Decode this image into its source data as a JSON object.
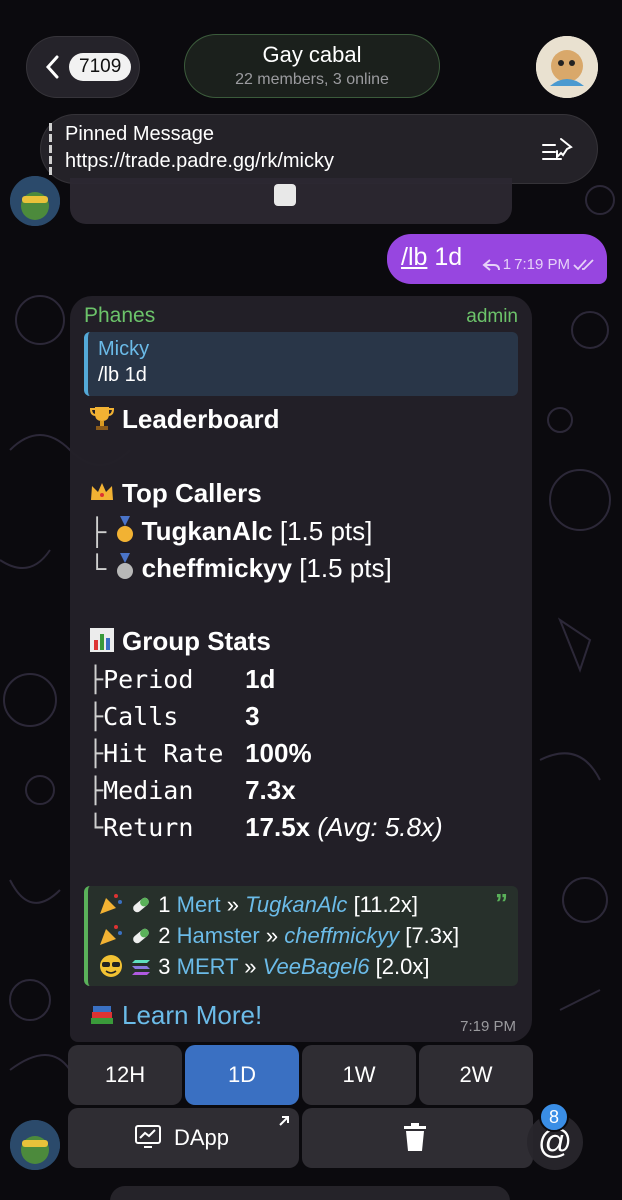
{
  "header": {
    "unread_count": "7109",
    "chat_title": "Gay cabal",
    "chat_subtitle": "22 members, 3 online"
  },
  "pinned": {
    "label": "Pinned Message",
    "text": "https://trade.padre.gg/rk/micky"
  },
  "outgoing": {
    "command": "/lb",
    "arg": " 1d",
    "replies": "1",
    "time": "7:19 PM"
  },
  "message": {
    "sender": "Phanes",
    "role": "admin",
    "reply_name": "Micky",
    "reply_text": "/lb 1d",
    "heading": "Leaderboard",
    "top_callers_title": "Top Callers",
    "top_callers": [
      {
        "prefix": "├",
        "name": "TugkanAlc",
        "pts": "[1.5 pts]"
      },
      {
        "prefix": "└",
        "name": "cheffmickyy",
        "pts": "[1.5 pts]"
      }
    ],
    "stats_title": "Group Stats",
    "stats": [
      {
        "prefix": "├",
        "label": "Period",
        "value": "1d",
        "extra": ""
      },
      {
        "prefix": "├",
        "label": "Calls",
        "value": "3",
        "extra": ""
      },
      {
        "prefix": "├",
        "label": "Hit Rate",
        "value": "100%",
        "extra": ""
      },
      {
        "prefix": "├",
        "label": "Median",
        "value": "7.3x",
        "extra": ""
      },
      {
        "prefix": "└",
        "label": "Return",
        "value": "17.5x",
        "extra": "(Avg: 5.8x)"
      }
    ],
    "calls": [
      {
        "rank": "1",
        "token": "Mert",
        "sep": "»",
        "caller": "TugkanAlc",
        "mult": "[11.2x]"
      },
      {
        "rank": "2",
        "token": "Hamster",
        "sep": "»",
        "caller": "cheffmickyy",
        "mult": "[7.3x]"
      },
      {
        "rank": "3",
        "token": "MERT",
        "sep": "»",
        "caller": "VeeBagel6",
        "mult": "[2.0x]"
      }
    ],
    "learn_more": "Learn More!",
    "time": "7:19 PM"
  },
  "keyboard": {
    "periods": [
      "12H",
      "1D",
      "1W",
      "2W"
    ],
    "active": "1D",
    "dapp": "DApp"
  },
  "mentions_count": "8",
  "colors": {
    "accent_green": "#6cc36a",
    "link_blue": "#6bbbe8",
    "outgoing_purple": "#9746e0",
    "active_button": "#3a70c2"
  }
}
